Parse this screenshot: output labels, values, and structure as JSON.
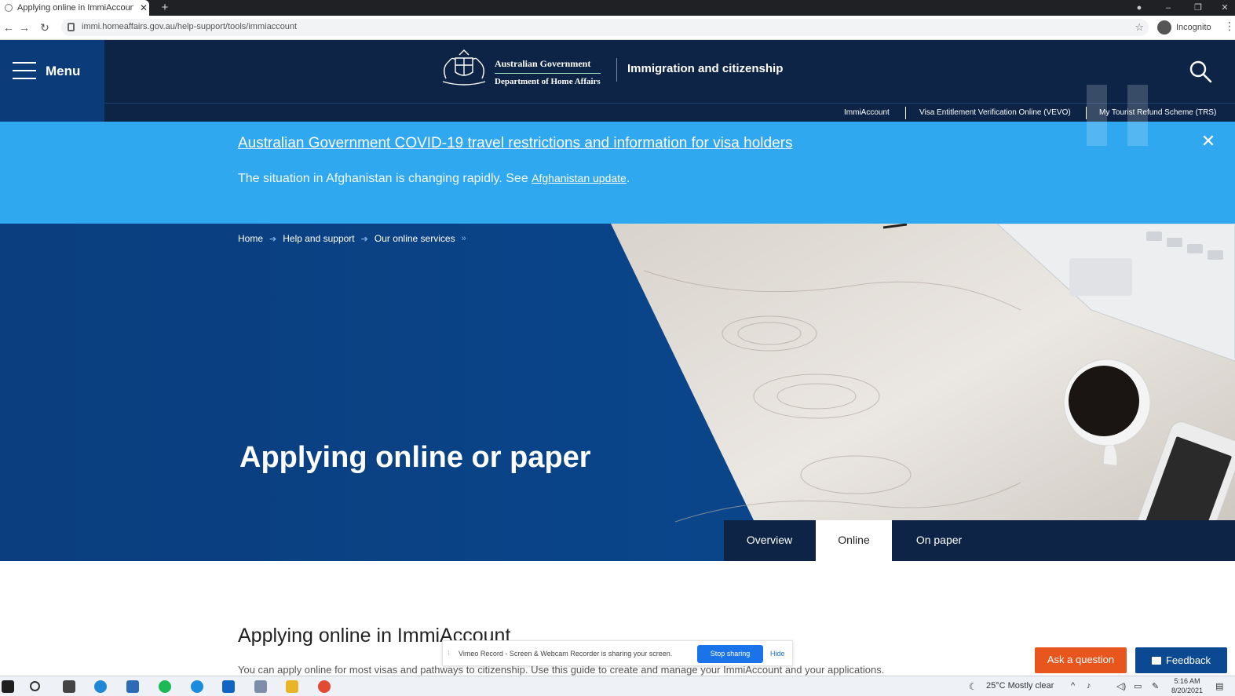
{
  "browser": {
    "tab_title": "Applying online in ImmiAccount",
    "url": "immi.homeaffairs.gov.au/help-support/tools/immiaccount",
    "incognito_label": "Incognito"
  },
  "header": {
    "menu_label": "Menu",
    "gov_line1": "Australian Government",
    "gov_line2": "Department of Home Affairs",
    "portal_title": "Immigration and citizenship",
    "subnav": [
      "ImmiAccount",
      "Visa Entitlement Verification Online (VEVO)",
      "My Tourist Refund Scheme (TRS)"
    ]
  },
  "alert": {
    "headline": "Australian Government COVID-19 travel restrictions and information for visa holders",
    "message": "The situation in Afghanistan is changing rapidly. See ",
    "link": "Afghanistan update",
    "message_end": "."
  },
  "breadcrumb": [
    "Home",
    "Help and support",
    "Our online services"
  ],
  "hero": {
    "title": "Applying online or paper",
    "tabs": [
      {
        "label": "Overview",
        "active": false
      },
      {
        "label": "Online",
        "active": true
      },
      {
        "label": "On paper",
        "active": false
      }
    ]
  },
  "content": {
    "heading": "Applying online in ImmiAccount",
    "intro": "You can apply online for most visas and pathways to citizenship. Use this guide to create and manage your ImmiAccount and your applications."
  },
  "screen_share": {
    "message": "Vimeo Record - Screen & Webcam Recorder is sharing your screen.",
    "stop_label": "Stop sharing",
    "hide_label": "Hide"
  },
  "floating": {
    "ask_label": "Ask a question",
    "feedback_label": "Feedback"
  },
  "taskbar": {
    "weather": "25°C  Mostly clear",
    "time": "5:16 AM",
    "date": "8/20/2021"
  },
  "colors": {
    "header_navy": "#0d2446",
    "menu_blue": "#0c3b7a",
    "alert_blue": "#2fa8f0",
    "hero_blue": "#0b4a93",
    "ask_orange": "#e8561e"
  }
}
